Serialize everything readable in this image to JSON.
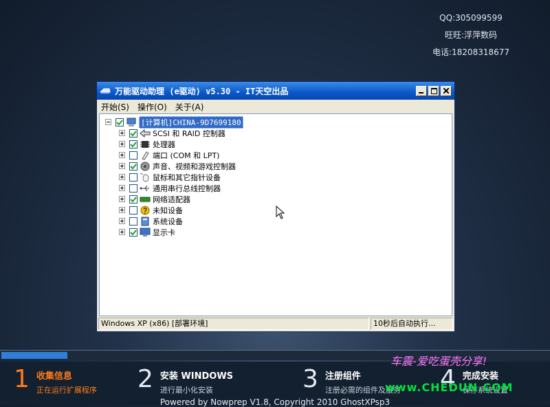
{
  "contact": {
    "qq": "QQ:305099599",
    "wangwang": "旺旺:浮萍数码",
    "phone": "电话:18208318677"
  },
  "window": {
    "title": "万能驱动助理 (e驱动) v5.30 - IT天空出品",
    "menu": [
      "开始(S)",
      "操作(O)",
      "关于(A)"
    ],
    "tree": {
      "root": {
        "label": "[计算机]CHINA-9D7699180",
        "checked": true
      },
      "items": [
        {
          "label": "SCSI 和 RAID 控制器",
          "checked": true,
          "icon": "scsi-icon"
        },
        {
          "label": "处理器",
          "checked": true,
          "icon": "processor-icon"
        },
        {
          "label": "端口 (COM 和 LPT)",
          "checked": false,
          "icon": "port-icon"
        },
        {
          "label": "声音、视频和游戏控制器",
          "checked": true,
          "icon": "sound-icon"
        },
        {
          "label": "鼠标和其它指针设备",
          "checked": false,
          "icon": "mouse-icon"
        },
        {
          "label": "通用串行总线控制器",
          "checked": false,
          "icon": "usb-icon"
        },
        {
          "label": "网络适配器",
          "checked": true,
          "icon": "network-icon"
        },
        {
          "label": "未知设备",
          "checked": false,
          "icon": "unknown-device-icon"
        },
        {
          "label": "系统设备",
          "checked": false,
          "icon": "system-device-icon"
        },
        {
          "label": "显示卡",
          "checked": true,
          "icon": "display-adapter-icon"
        }
      ]
    },
    "status": {
      "left": "Windows XP (x86) [部署环境]",
      "right": "10秒后自动执行..."
    }
  },
  "progress": {
    "fraction": 0.12
  },
  "steps": [
    {
      "num": "1",
      "title": "收集信息",
      "subtitle": "正在运行扩展程序",
      "active": true
    },
    {
      "num": "2",
      "title": "安装 WINDOWS",
      "subtitle": "进行最小化安装",
      "active": false
    },
    {
      "num": "3",
      "title": "注册组件",
      "subtitle": "注册必需的组件及服务",
      "active": false
    },
    {
      "num": "4",
      "title": "完成安装",
      "subtitle": "保存系统设置",
      "active": false
    }
  ],
  "footer": "Powered by Nowprep V1.8, Copyright 2010 GhostXPsp3",
  "watermark": {
    "line1": "车震-爱吃蛋壳分享!",
    "line2": "www.CHEDUN.COM"
  },
  "colors": {
    "titlebar": "#0a58c9",
    "accent_step": "#ff7a1a",
    "progress": "#2f7fd9"
  }
}
